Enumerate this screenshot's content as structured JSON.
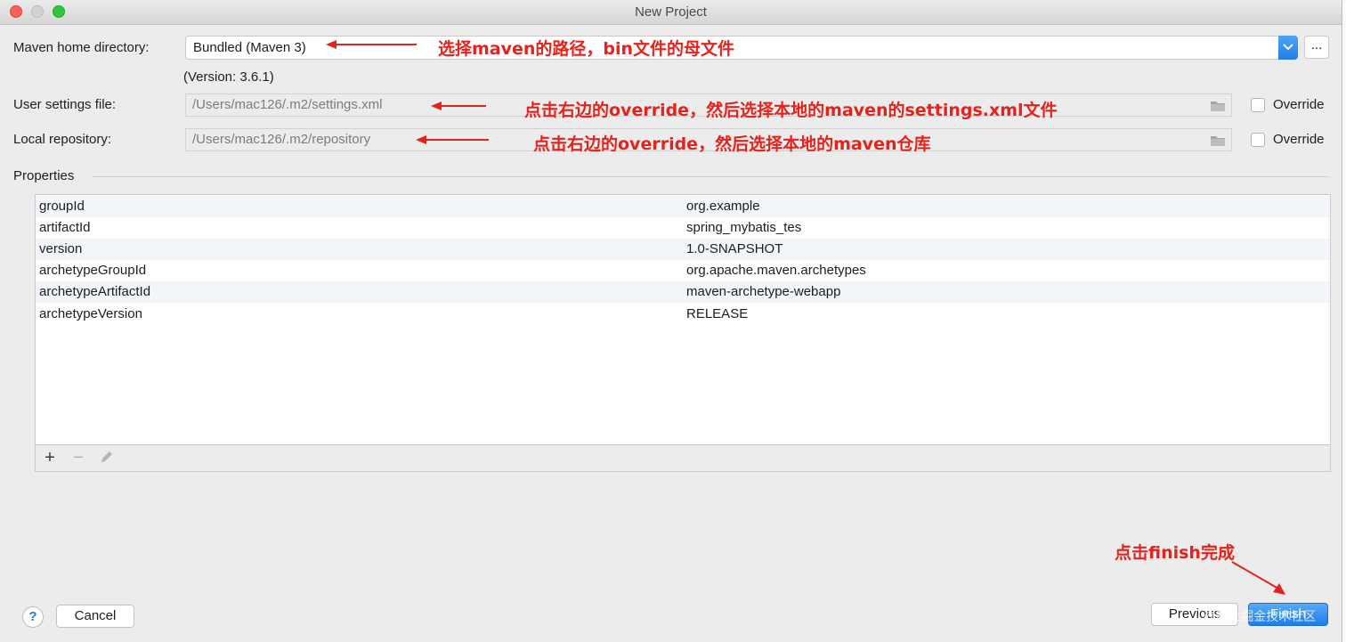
{
  "window": {
    "title": "New Project"
  },
  "form": {
    "maven_home_label": "Maven home directory:",
    "maven_home_value": "Bundled (Maven 3)",
    "dots_label": "...",
    "version_text": "(Version: 3.6.1)",
    "user_settings_label": "User settings file:",
    "user_settings_value": "/Users/mac126/.m2/settings.xml",
    "local_repo_label": "Local repository:",
    "local_repo_value": "/Users/mac126/.m2/repository",
    "override_label": "Override"
  },
  "properties": {
    "section_label": "Properties",
    "rows": [
      {
        "key": "groupId",
        "value": "org.example"
      },
      {
        "key": "artifactId",
        "value": "spring_mybatis_tes"
      },
      {
        "key": "version",
        "value": "1.0-SNAPSHOT"
      },
      {
        "key": "archetypeGroupId",
        "value": "org.apache.maven.archetypes"
      },
      {
        "key": "archetypeArtifactId",
        "value": "maven-archetype-webapp"
      },
      {
        "key": "archetypeVersion",
        "value": "RELEASE"
      }
    ],
    "toolbar": {
      "add": "+",
      "remove": "−"
    }
  },
  "footer": {
    "help_label": "?",
    "cancel_label": "Cancel",
    "previous_label": "Previous",
    "finish_label": "Finish"
  },
  "annotations": {
    "maven_home": "选择maven的路径，bin文件的母文件",
    "settings": "点击右边的override，然后选择本地的maven的settings.xml文件",
    "repository": "点击右边的override，然后选择本地的maven仓库",
    "finish": "点击finish完成"
  },
  "watermark": "@稀土掘金技术社区",
  "colors": {
    "accent": "#1f7fe8",
    "annotation": "#e4231d"
  }
}
